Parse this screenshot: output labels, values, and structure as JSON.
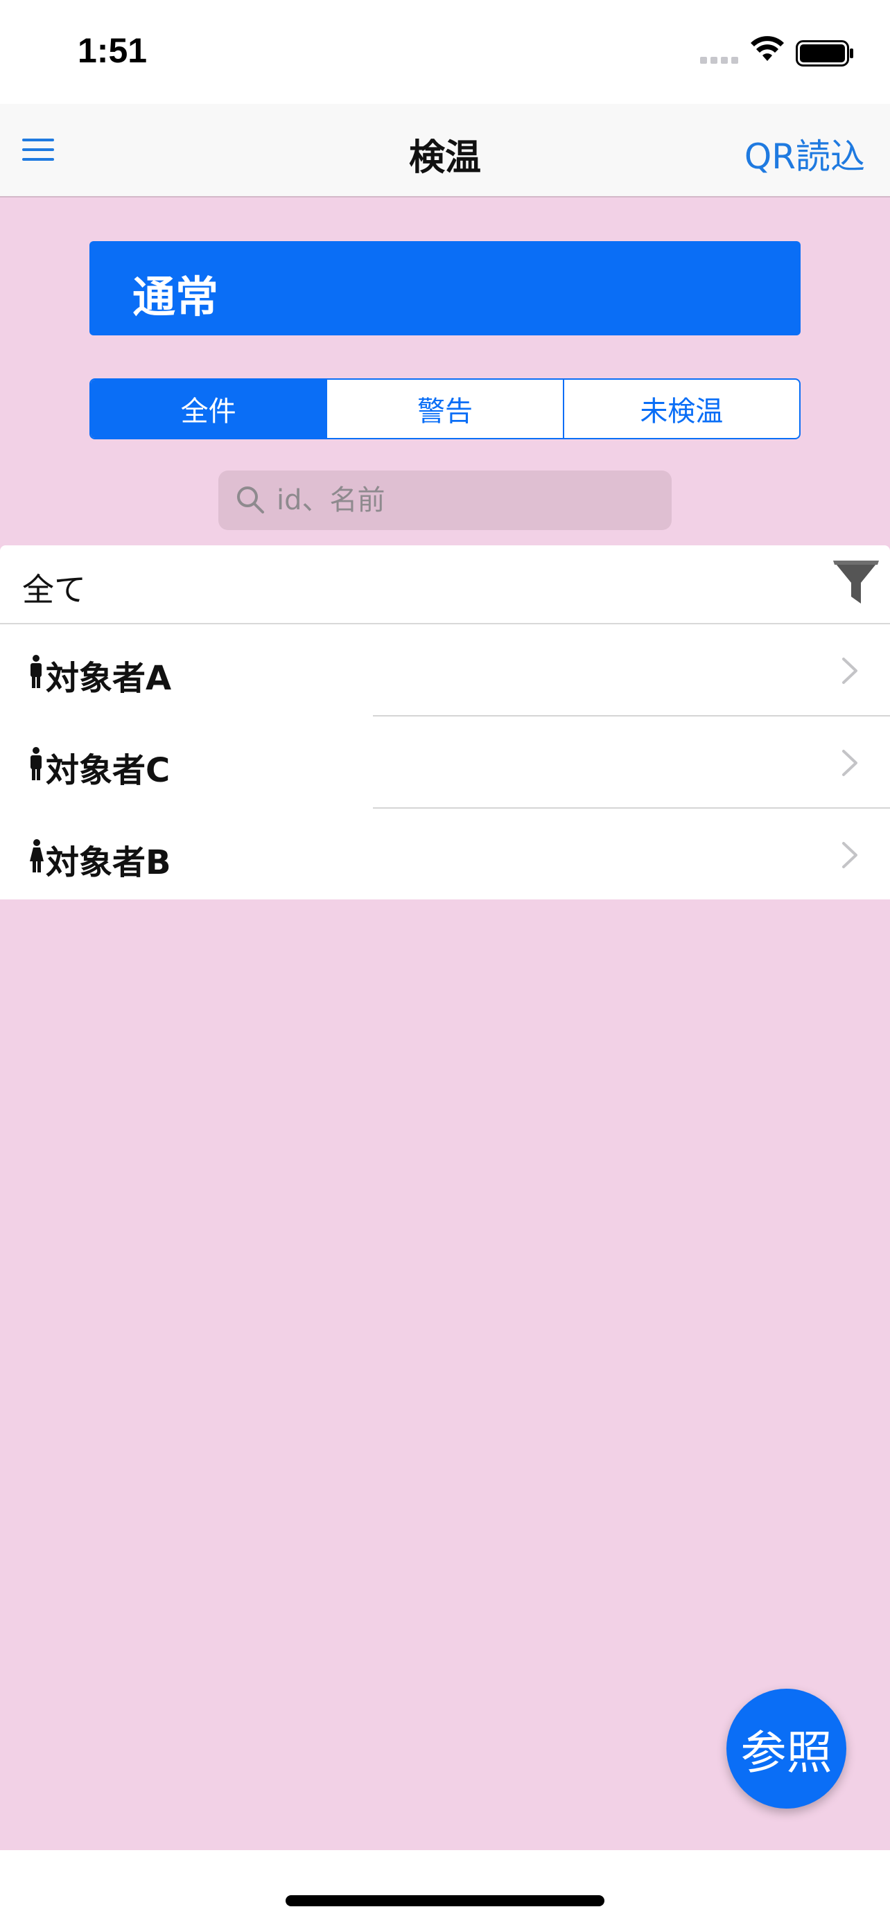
{
  "status_bar": {
    "time": "1:51"
  },
  "nav": {
    "title": "検温",
    "right_action": "QR読込",
    "menu_icon": "hamburger-icon"
  },
  "mode_banner": {
    "label": "通常"
  },
  "segments": [
    {
      "label": "全件",
      "active": true
    },
    {
      "label": "警告",
      "active": false
    },
    {
      "label": "未検温",
      "active": false
    }
  ],
  "search": {
    "placeholder": "id、名前",
    "value": ""
  },
  "filter": {
    "label": "全て",
    "icon": "filter-icon"
  },
  "list": {
    "items": [
      {
        "name": "対象者A",
        "icon": "person-male-icon"
      },
      {
        "name": "対象者C",
        "icon": "person-male-icon"
      },
      {
        "name": "対象者B",
        "icon": "person-female-icon"
      }
    ]
  },
  "fab": {
    "label": "参照"
  },
  "colors": {
    "accent": "#0a6ef6",
    "background": "#f2d1e6",
    "nav_link": "#1f7ae0"
  }
}
